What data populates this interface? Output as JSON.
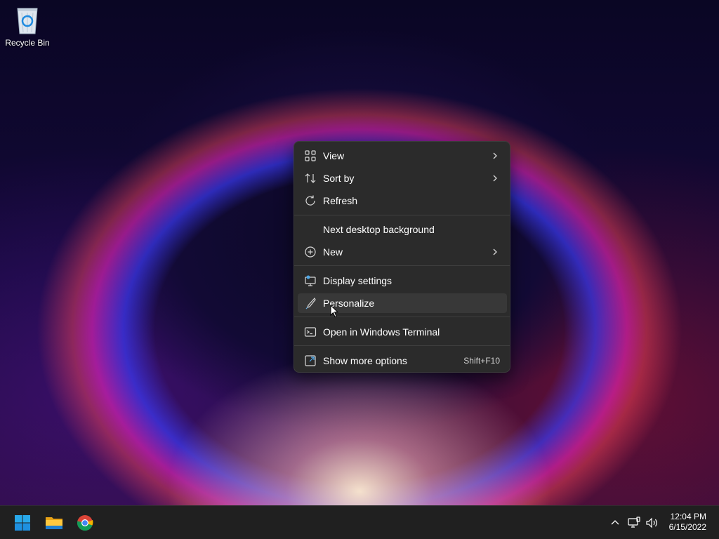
{
  "desktop": {
    "icons": [
      {
        "label": "Recycle Bin",
        "icon": "recycle-bin-icon"
      }
    ]
  },
  "context_menu": {
    "items": [
      {
        "label": "View",
        "icon": "grid-icon",
        "submenu": true
      },
      {
        "label": "Sort by",
        "icon": "sort-icon",
        "submenu": true
      },
      {
        "label": "Refresh",
        "icon": "refresh-icon",
        "submenu": false
      },
      {
        "label": "Next desktop background",
        "icon": "",
        "submenu": false
      },
      {
        "label": "New",
        "icon": "plus-circle-icon",
        "submenu": true
      },
      {
        "label": "Display settings",
        "icon": "display-settings-icon",
        "submenu": false
      },
      {
        "label": "Personalize",
        "icon": "brush-icon",
        "submenu": false,
        "hovered": true
      },
      {
        "label": "Open in Windows Terminal",
        "icon": "terminal-icon",
        "submenu": false
      },
      {
        "label": "Show more options",
        "icon": "more-options-icon",
        "submenu": false,
        "shortcut": "Shift+F10"
      }
    ]
  },
  "taskbar": {
    "pinned": [
      {
        "name": "Start",
        "icon": "windows-logo-icon"
      },
      {
        "name": "File Explorer",
        "icon": "folder-icon"
      },
      {
        "name": "Google Chrome",
        "icon": "chrome-icon"
      }
    ],
    "tray": {
      "time": "12:04 PM",
      "date": "6/15/2022",
      "icons": [
        "chevron-up-icon",
        "network-icon",
        "volume-icon"
      ]
    }
  },
  "colors": {
    "menu_bg": "#2b2b2b",
    "menu_hover": "#383838",
    "taskbar_bg": "#202020",
    "accent": "#0078d4"
  }
}
